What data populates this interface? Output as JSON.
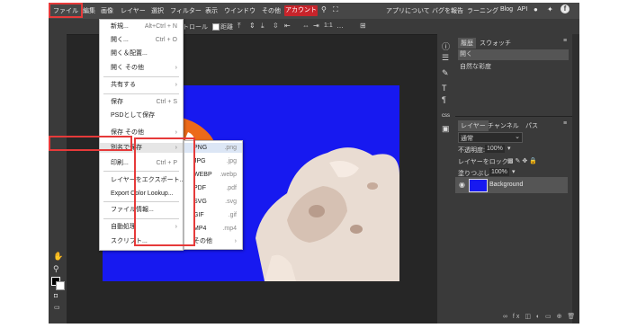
{
  "menubar": {
    "items": [
      {
        "label": "ファイル"
      },
      {
        "label": "編集"
      },
      {
        "label": "画像"
      },
      {
        "label": "レイヤー"
      },
      {
        "label": "選択"
      },
      {
        "label": "フィルター"
      },
      {
        "label": "表示"
      },
      {
        "label": "ウインドウ"
      },
      {
        "label": "その他"
      },
      {
        "label": "アカウント"
      }
    ],
    "right_links": [
      "アプリについて",
      "バグを報告",
      "ラーニング",
      "Blog",
      "API"
    ]
  },
  "options_bar": {
    "transform_controls": "変換コントロール",
    "distance": "距離",
    "zoom_hint": "1:1"
  },
  "file_menu": {
    "items": [
      {
        "label": "新規...",
        "shortcut": "Alt+Ctrl + N"
      },
      {
        "label": "開く...",
        "shortcut": "Ctrl + O"
      },
      {
        "label": "開く＆配置...",
        "shortcut": ""
      },
      {
        "label": "開く その他",
        "shortcut": "›"
      },
      {
        "label": "共有する",
        "shortcut": "›"
      },
      {
        "label": "保存",
        "shortcut": "Ctrl + S"
      },
      {
        "label": "PSDとして保存",
        "shortcut": ""
      },
      {
        "label": "保存 その他",
        "shortcut": "›"
      },
      {
        "label": "別名で保存",
        "shortcut": "›"
      },
      {
        "label": "印刷...",
        "shortcut": "Ctrl + P"
      },
      {
        "label": "レイヤーをエクスポート...",
        "shortcut": ""
      },
      {
        "label": "Export Color Lookup...",
        "shortcut": ""
      },
      {
        "label": "ファイル情報...",
        "shortcut": ""
      },
      {
        "label": "自動処理",
        "shortcut": "›"
      },
      {
        "label": "スクリプト...",
        "shortcut": ""
      }
    ]
  },
  "save_as_submenu": {
    "items": [
      {
        "label": "PNG",
        "ext": ".png"
      },
      {
        "label": "JPG",
        "ext": ".jpg"
      },
      {
        "label": "WEBP",
        "ext": ".webp"
      },
      {
        "label": "PDF",
        "ext": ".pdf"
      },
      {
        "label": "SVG",
        "ext": ".svg"
      },
      {
        "label": "GIF",
        "ext": ".gif"
      },
      {
        "label": "MP4",
        "ext": ".mp4"
      },
      {
        "label": "その他",
        "ext": "›"
      }
    ]
  },
  "history_panel": {
    "tabs": [
      "履歴",
      "スウォッチ"
    ],
    "entries": [
      "開く",
      "自然な彩度"
    ]
  },
  "layers_panel": {
    "tabs": [
      "レイヤー",
      "チャンネル",
      "パス"
    ],
    "blend_mode": "通常",
    "opacity_label": "不透明度:",
    "opacity_value": "100%",
    "lock_label": "レイヤーをロック:",
    "fill_label": "塗りつぶし:",
    "fill_value": "100%",
    "layer_name": "Background"
  },
  "colors": {
    "accent_red": "#e63a3a",
    "account_bg": "#c8242b",
    "canvas_blue": "#1719f0"
  }
}
